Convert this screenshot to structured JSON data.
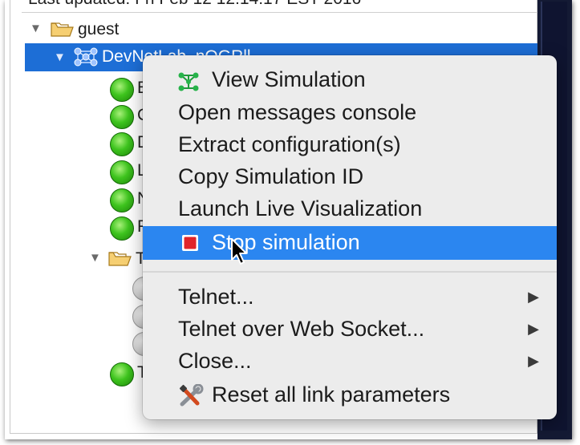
{
  "tree": {
    "last_updated": "Last updated: Fri Feb 12 12:14:17 EST 2016",
    "root_label": "guest",
    "selected_label": "DevNetLab_nQGRll",
    "node_letters": [
      "E",
      "C",
      "D",
      "L",
      "N",
      "F"
    ],
    "subfolder_label": "T",
    "extra_node_letter": "T"
  },
  "context_menu": {
    "items": [
      {
        "label": "View Simulation",
        "icon": "network-topology-icon"
      },
      {
        "label": "Open messages console"
      },
      {
        "label": "Extract configuration(s)"
      },
      {
        "label": "Copy Simulation ID"
      },
      {
        "label": "Launch Live Visualization"
      },
      {
        "label": "Stop simulation",
        "icon": "stop-icon",
        "highlighted": true
      }
    ],
    "submenus": [
      {
        "label": "Telnet...",
        "arrow": "▶"
      },
      {
        "label": "Telnet over Web Socket...",
        "arrow": "▶"
      },
      {
        "label": "Close...",
        "arrow": "▶"
      }
    ],
    "reset": {
      "label": "Reset all link parameters",
      "icon": "tools-icon"
    }
  },
  "colors": {
    "selection": "#1d6ed6",
    "menu_highlight": "#2b86f0",
    "menu_background": "#ececec",
    "side_panel": "#141a34"
  }
}
